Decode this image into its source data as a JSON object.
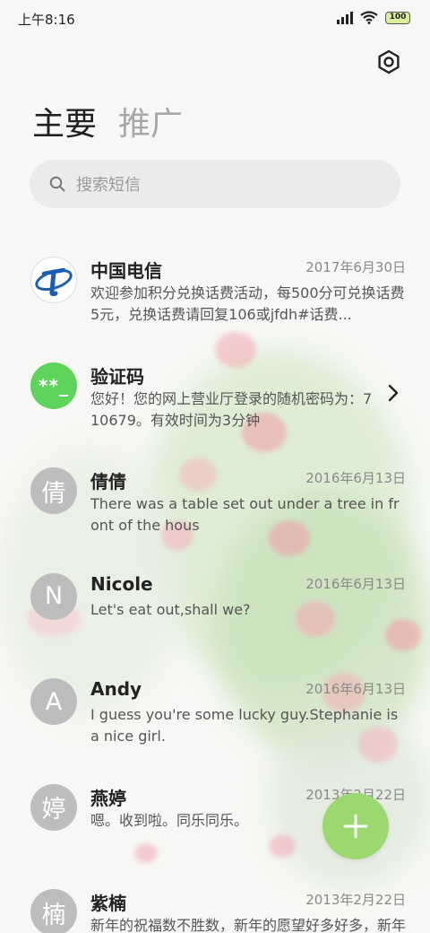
{
  "status_bar": {
    "time": "上午8:16",
    "battery": "100"
  },
  "tabs": [
    {
      "label": "主要",
      "active": true
    },
    {
      "label": "推广",
      "active": false
    }
  ],
  "search": {
    "placeholder": "搜索短信"
  },
  "conversations": [
    {
      "name": "中国电信",
      "date": "2017年6月30日",
      "preview": "欢迎参加积分兑换话费活动，每500分可兑换话费5元，兑换话费请回复106或jfdh#话费...",
      "avatar": "china-telecom-logo"
    },
    {
      "name": "验证码",
      "date": "",
      "preview": "您好！您的网上营业厅登录的随机密码为：710679。有效时间为3分钟",
      "avatar_text": "**_"
    },
    {
      "name": "倩倩",
      "date": "2016年6月13日",
      "preview": "There was a table set out under a tree in front of the hous",
      "avatar_text": "倩"
    },
    {
      "name": "Nicole",
      "date": "2016年6月13日",
      "preview": "Let's eat out,shall we?",
      "avatar_text": "N"
    },
    {
      "name": "Andy",
      "date": "2016年6月13日",
      "preview": "I guess you're some lucky guy.Stephanie is a nice girl.",
      "avatar_text": "A"
    },
    {
      "name": "燕婷",
      "date": "2013年2月22日",
      "preview": "嗯。收到啦。同乐同乐。",
      "avatar_text": "婷"
    },
    {
      "name": "紫楠",
      "date": "2013年2月22日",
      "preview": "新年的祝福数不胜数，新年的愿望好多好多，新年的问候依旧美好，在这个温馨的时刻，...",
      "avatar_text": "楠"
    }
  ],
  "colors": {
    "accent_green": "#5fd45a",
    "fab": "#9bd96f",
    "avatar_gray": "#bdbdbd"
  },
  "icons": [
    "gear-icon",
    "search-icon",
    "chevron-right-icon",
    "plus-icon",
    "wifi-icon",
    "signal-icon",
    "battery-icon"
  ]
}
